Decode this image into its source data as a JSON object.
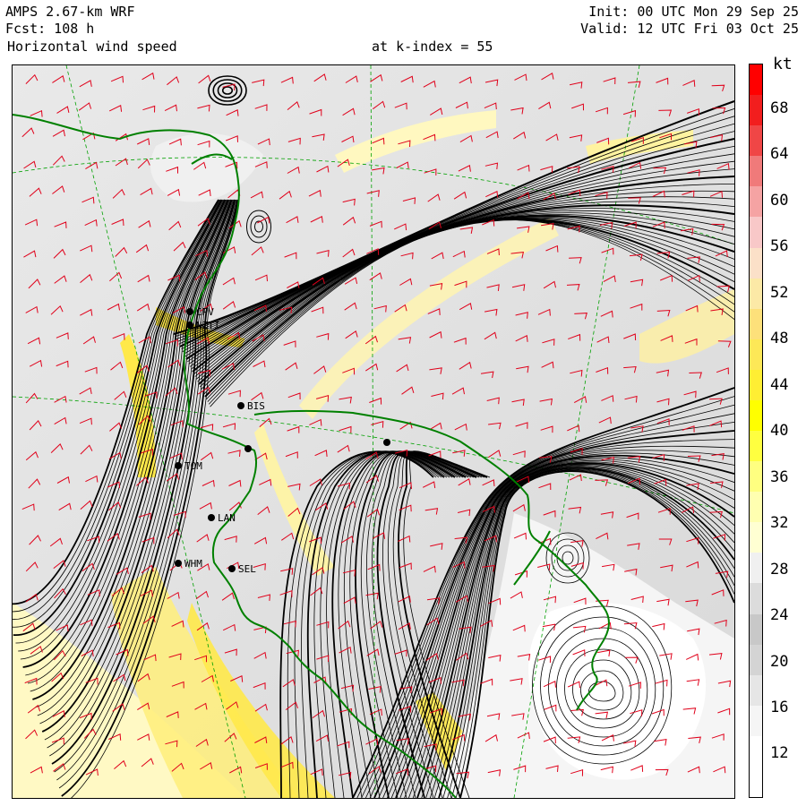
{
  "header": {
    "model": "AMPS 2.67-km WRF",
    "forecast": "Fcst: 108 h",
    "field": "Horizontal wind speed",
    "level": "at k-index = 55",
    "init": "Init: 00 UTC Mon 29 Sep 25",
    "valid": "Valid: 12 UTC Fri 03 Oct 25"
  },
  "colorbar": {
    "unit": "kt",
    "labels": [
      "68",
      "64",
      "60",
      "56",
      "52",
      "48",
      "44",
      "40",
      "36",
      "32",
      "28",
      "24",
      "20",
      "16",
      "12"
    ],
    "colors": [
      "#ff0000",
      "#f21e1e",
      "#f04646",
      "#f07a7a",
      "#f5a3a3",
      "#f8c8c8",
      "#fbe0c8",
      "#fce9a6",
      "#fde07a",
      "#fde857",
      "#ffee33",
      "#ffff00",
      "#ffff40",
      "#ffff80",
      "#ffffb0",
      "#ffffd2",
      "#f0f0f0",
      "#dcdcdc",
      "#c8c8c8",
      "#d4d4d4",
      "#e6e6e6",
      "#f5f5f5",
      "#ffffff",
      "#ffffff"
    ]
  },
  "stations": [
    {
      "name": "CPV"
    },
    {
      "name": "NZTI"
    },
    {
      "name": "BIS"
    },
    {
      "name": "TOM"
    },
    {
      "name": "LAN"
    },
    {
      "name": "WHM"
    },
    {
      "name": "SEL"
    }
  ],
  "colors": {
    "coastline": "#008000",
    "barbs": "#e0001a",
    "streamlines": "#000000",
    "grid": "#00a000"
  }
}
